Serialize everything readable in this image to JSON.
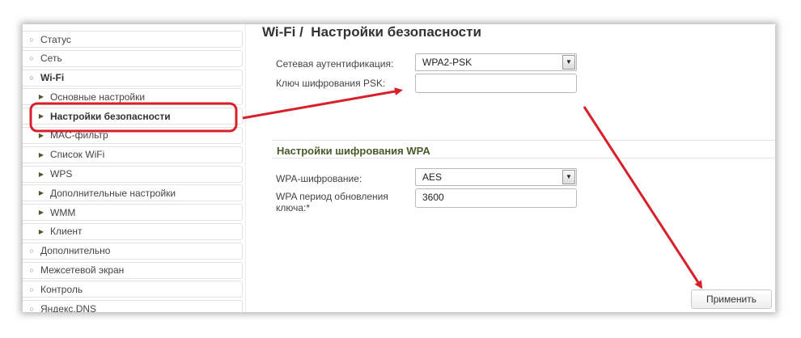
{
  "sidebar": {
    "items": [
      {
        "label": "Статус",
        "icon": "chevron-right-icon"
      },
      {
        "label": "Сеть",
        "icon": "chevron-right-icon"
      },
      {
        "label": "Wi-Fi",
        "icon": "chevron-down-icon"
      },
      {
        "label": "Основные настройки",
        "icon": "arrow-right-icon"
      },
      {
        "label": "Настройки безопасности",
        "icon": "arrow-right-icon"
      },
      {
        "label": "MAC-фильтр",
        "icon": "arrow-right-icon"
      },
      {
        "label": "Список WiFi",
        "icon": "arrow-right-icon"
      },
      {
        "label": "WPS",
        "icon": "arrow-right-icon"
      },
      {
        "label": "Дополнительные настройки",
        "icon": "arrow-right-icon"
      },
      {
        "label": "WMM",
        "icon": "arrow-right-icon"
      },
      {
        "label": "Клиент",
        "icon": "arrow-right-icon"
      },
      {
        "label": "Дополнительно",
        "icon": "chevron-right-icon"
      },
      {
        "label": "Межсетевой экран",
        "icon": "chevron-right-icon"
      },
      {
        "label": "Контроль",
        "icon": "chevron-right-icon"
      },
      {
        "label": "Яндекс.DNS",
        "icon": "chevron-right-icon"
      }
    ]
  },
  "header": {
    "crumb": "Wi-Fi /",
    "title": "Настройки безопасности"
  },
  "form": {
    "auth_label": "Сетевая аутентификация:",
    "auth_value": "WPA2-PSK",
    "psk_label": "Ключ шифрования PSK:",
    "psk_value": "",
    "wpa_section": "Настройки шифрования WPA",
    "wpa_cipher_label": "WPA-шифрование:",
    "wpa_cipher_value": "AES",
    "rekey_label_line1": "WPA период обновления",
    "rekey_label_line2": "ключа:*",
    "rekey_value": "3600"
  },
  "actions": {
    "apply_label": "Применить"
  },
  "colors": {
    "accent_green": "#4a5a2a",
    "annotation_red": "#d8202a"
  }
}
